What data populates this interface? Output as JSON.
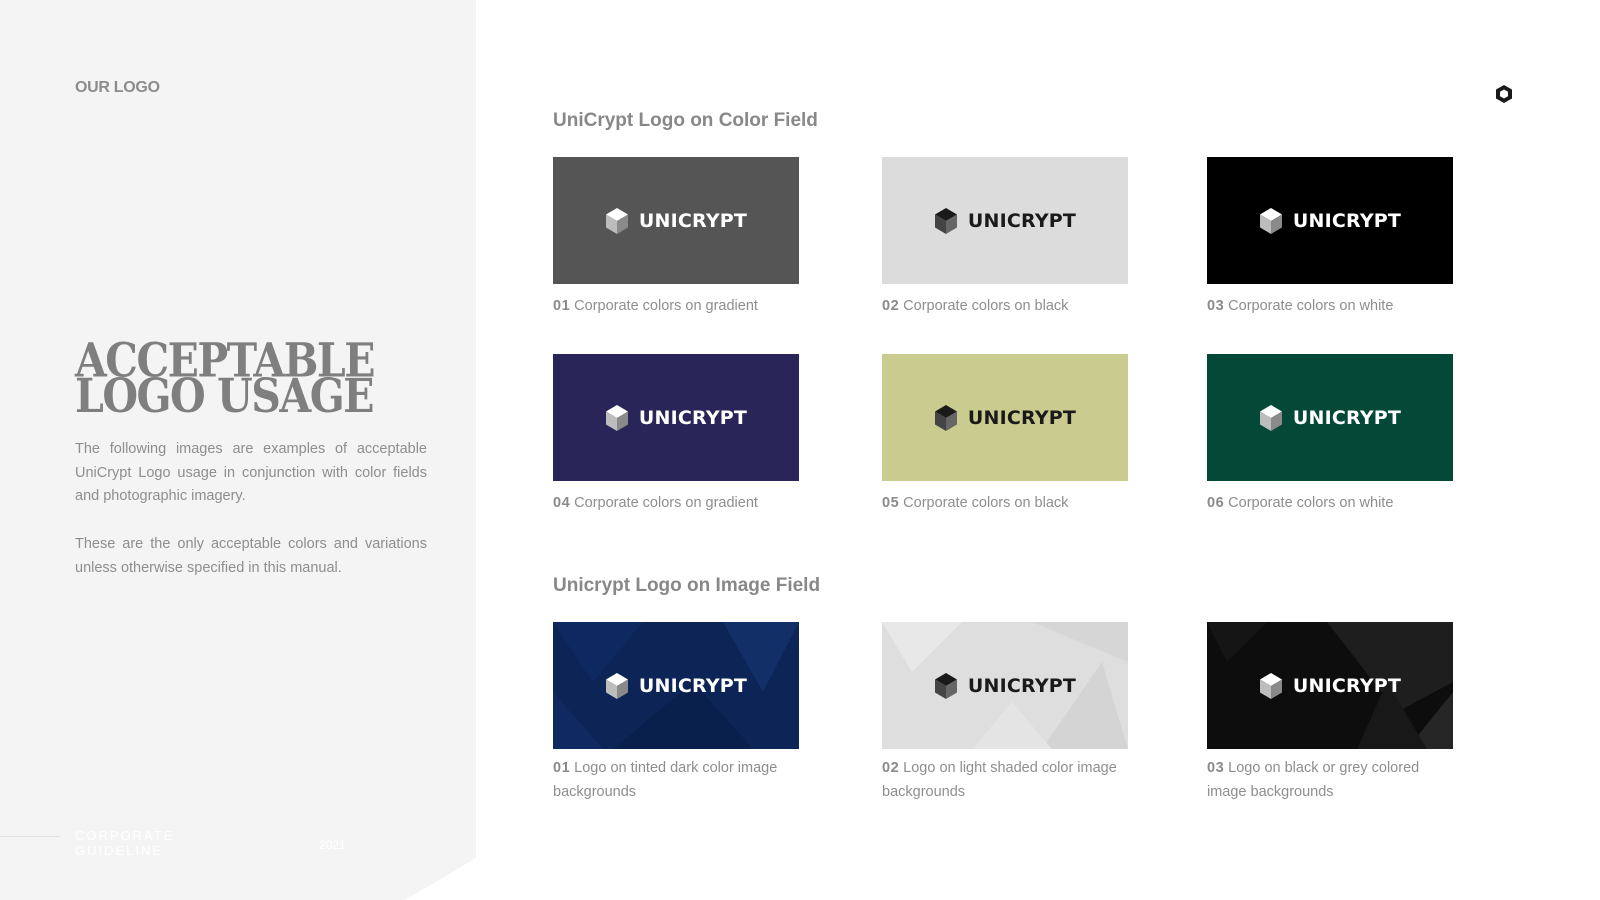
{
  "sidebar": {
    "section_label": "OUR LOGO",
    "title_line1": "ACCEPTABLE",
    "title_line2": "LOGO USAGE",
    "paragraph1": "The following images are examples of acceptable UniCrypt Logo usage in conjunction with color fields and photographic imagery.",
    "paragraph2": "These are the only acceptable colors and variations unless otherwise specified in this manual.",
    "footer_text": "CORPORATE GUIDELINE",
    "footer_year": "2021"
  },
  "brand": {
    "wordmark": "UNICRYPT",
    "corner_icon": "hexagon-logo-icon"
  },
  "color_field": {
    "heading": "UniCrypt Logo on Color Field",
    "items": [
      {
        "num": "01",
        "caption": "Corporate colors on gradient",
        "bg": "#555555",
        "text_color": "#ffffff"
      },
      {
        "num": "02",
        "caption": "Corporate colors on black",
        "bg": "#dcdcdc",
        "text_color": "#1a1a1a"
      },
      {
        "num": "03",
        "caption": "Corporate colors on white",
        "bg": "#000000",
        "text_color": "#ffffff"
      },
      {
        "num": "04",
        "caption": "Corporate colors on gradient",
        "bg": "#2a2558",
        "text_color": "#ffffff"
      },
      {
        "num": "05",
        "caption": "Corporate colors on black",
        "bg": "#c9cc8e",
        "text_color": "#1a1a1a"
      },
      {
        "num": "06",
        "caption": "Corporate colors on white",
        "bg": "#044838",
        "text_color": "#ffffff"
      }
    ]
  },
  "image_field": {
    "heading": "Unicrypt Logo on Image Field",
    "items": [
      {
        "num": "01",
        "caption": "Logo on tinted dark color image backgrounds",
        "bg": "#0c2456",
        "text_color": "#ffffff"
      },
      {
        "num": "02",
        "caption": "Logo on light shaded color image backgrounds",
        "bg": "#dedede",
        "text_color": "#1a1a1a"
      },
      {
        "num": "03",
        "caption": "Logo on black or grey colored image backgrounds",
        "bg": "#0d0d0d",
        "text_color": "#ffffff"
      }
    ]
  }
}
